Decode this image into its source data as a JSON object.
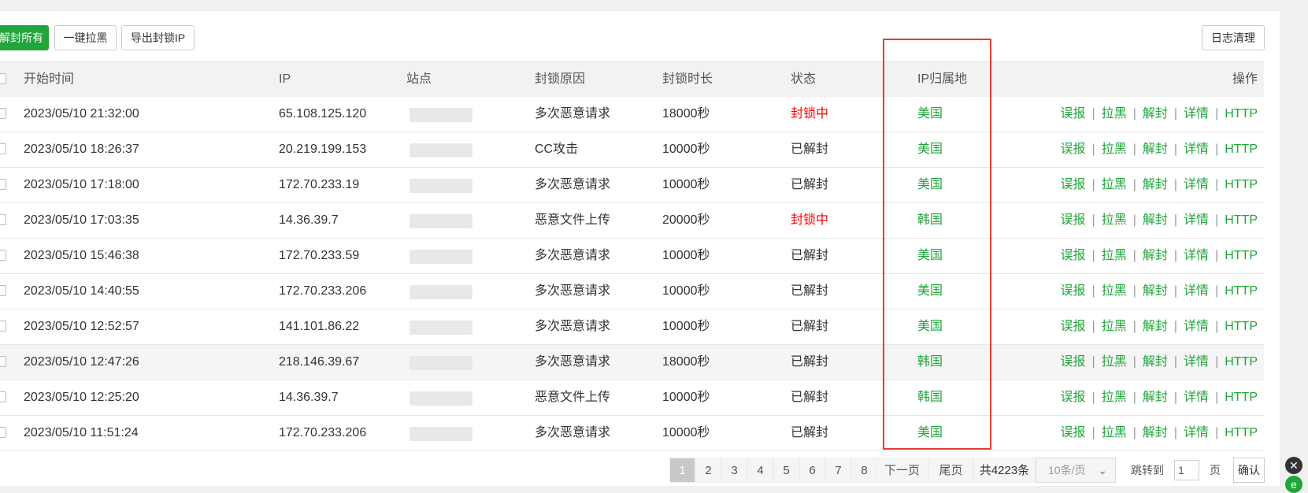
{
  "toolbar": {
    "unblock_all": "解封所有",
    "blacklist_all": "一键拉黑",
    "export_ips": "导出封锁IP",
    "clear_log": "日志清理"
  },
  "table": {
    "headers": {
      "time": "开始时间",
      "ip": "IP",
      "site": "站点",
      "reason": "封锁原因",
      "duration": "封锁时长",
      "status": "状态",
      "location": "IP归属地",
      "actions": "操作"
    },
    "actions": [
      "误报",
      "拉黑",
      "解封",
      "详情",
      "HTTP"
    ],
    "rows": [
      {
        "time": "2023/05/10 21:32:00",
        "ip": "65.108.125.120",
        "reason": "多次恶意请求",
        "duration": "18000秒",
        "status": "封锁中",
        "blocked": true,
        "location": "美国"
      },
      {
        "time": "2023/05/10 18:26:37",
        "ip": "20.219.199.153",
        "reason": "CC攻击",
        "duration": "10000秒",
        "status": "已解封",
        "blocked": false,
        "location": "美国"
      },
      {
        "time": "2023/05/10 17:18:00",
        "ip": "172.70.233.19",
        "reason": "多次恶意请求",
        "duration": "10000秒",
        "status": "已解封",
        "blocked": false,
        "location": "美国"
      },
      {
        "time": "2023/05/10 17:03:35",
        "ip": "14.36.39.7",
        "reason": "恶意文件上传",
        "duration": "20000秒",
        "status": "封锁中",
        "blocked": true,
        "location": "韩国"
      },
      {
        "time": "2023/05/10 15:46:38",
        "ip": "172.70.233.59",
        "reason": "多次恶意请求",
        "duration": "10000秒",
        "status": "已解封",
        "blocked": false,
        "location": "美国"
      },
      {
        "time": "2023/05/10 14:40:55",
        "ip": "172.70.233.206",
        "reason": "多次恶意请求",
        "duration": "10000秒",
        "status": "已解封",
        "blocked": false,
        "location": "美国"
      },
      {
        "time": "2023/05/10 12:52:57",
        "ip": "141.101.86.22",
        "reason": "多次恶意请求",
        "duration": "10000秒",
        "status": "已解封",
        "blocked": false,
        "location": "美国"
      },
      {
        "time": "2023/05/10 12:47:26",
        "ip": "218.146.39.67",
        "reason": "多次恶意请求",
        "duration": "18000秒",
        "status": "已解封",
        "blocked": false,
        "location": "韩国"
      },
      {
        "time": "2023/05/10 12:25:20",
        "ip": "14.36.39.7",
        "reason": "恶意文件上传",
        "duration": "10000秒",
        "status": "已解封",
        "blocked": false,
        "location": "韩国"
      },
      {
        "time": "2023/05/10 11:51:24",
        "ip": "172.70.233.206",
        "reason": "多次恶意请求",
        "duration": "10000秒",
        "status": "已解封",
        "blocked": false,
        "location": "美国"
      }
    ]
  },
  "pagination": {
    "pages": [
      "1",
      "2",
      "3",
      "4",
      "5",
      "6",
      "7",
      "8"
    ],
    "current": "1",
    "next": "下一页",
    "last": "尾页",
    "total": "共4223条",
    "per_page": "10条/页",
    "jump_label": "跳转到",
    "jump_value": "1",
    "page_unit": "页",
    "confirm": "确认"
  },
  "colors": {
    "accent": "#20a53a",
    "blocked": "#ff0000",
    "highlight_box": "#e53935"
  }
}
